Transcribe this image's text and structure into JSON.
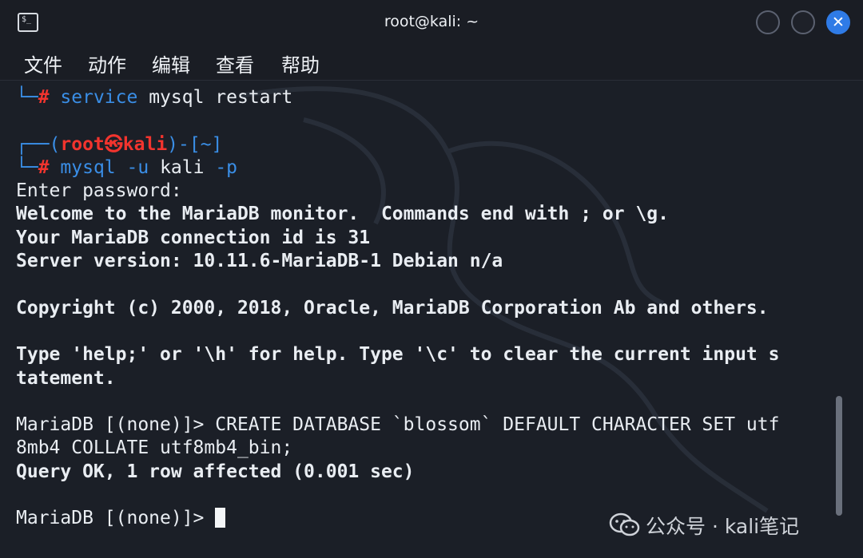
{
  "window": {
    "title": "root@kali: ~",
    "icon": "terminal-icon",
    "controls": [
      "minimize-button",
      "maximize-button",
      "close-button"
    ],
    "close_glyph": "✕"
  },
  "menu": {
    "items": [
      "文件",
      "动作",
      "编辑",
      "查看",
      "帮助"
    ]
  },
  "terminal": {
    "prompt_box_top": "┌──(",
    "prompt_user": "root",
    "prompt_skull": "㉿",
    "prompt_host": "kali",
    "prompt_dir": ")-[~]",
    "prompt_box_bottom": "└─",
    "prompt_hash": "#",
    "cmd1_word1": "service",
    "cmd1_rest": " mysql restart",
    "cmd2_word1": "mysql",
    "cmd2_flag1": "-u",
    "cmd2_arg": " kali ",
    "cmd2_flag2": "-p",
    "lines": [
      "Enter password:",
      "Welcome to the MariaDB monitor.  Commands end with ; or \\g.",
      "Your MariaDB connection id is 31",
      "Server version: 10.11.6-MariaDB-1 Debian n/a",
      "",
      "Copyright (c) 2000, 2018, Oracle, MariaDB Corporation Ab and others.",
      "",
      "Type 'help;' or '\\h' for help. Type '\\c' to clear the current input s",
      "tatement.",
      "",
      "MariaDB [(none)]> CREATE DATABASE `blossom` DEFAULT CHARACTER SET utf",
      "8mb4 COLLATE utf8mb4_bin;",
      "Query OK, 1 row affected (0.001 sec)",
      "",
      "MariaDB [(none)]> "
    ]
  },
  "watermark": {
    "label": "公众号 · kali笔记"
  },
  "colors": {
    "background": "#1b1f27",
    "prompt_blue": "#3a8ee6",
    "prompt_red": "#f2342e",
    "close_button": "#2f7be6"
  }
}
